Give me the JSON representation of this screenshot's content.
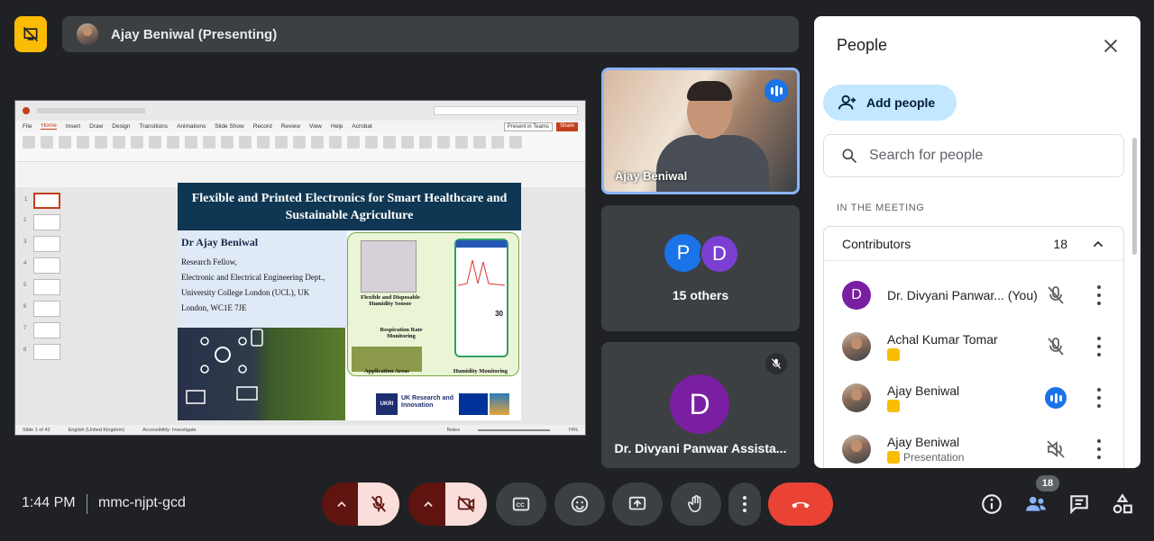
{
  "header": {
    "presenter_label": "Ajay Beniwal (Presenting)"
  },
  "shared_screen": {
    "ppt_menu": [
      "File",
      "Home",
      "Insert",
      "Draw",
      "Design",
      "Transitions",
      "Animations",
      "Slide Show",
      "Record",
      "Review",
      "View",
      "Help",
      "Acrobat"
    ],
    "thumb_numbers": [
      "1",
      "2",
      "3",
      "4",
      "5",
      "6",
      "7",
      "8"
    ],
    "present_in_teams": "Present in Teams",
    "share": "Share",
    "status_left": "Slide 1 of 42",
    "status_lang": "English (United Kingdom)",
    "status_access": "Accessibility: Investigate",
    "status_notes": "Notes",
    "status_zoom": "74%",
    "slide": {
      "title": "Flexible and Printed Electronics for Smart Healthcare and Sustainable Agriculture",
      "author": "Dr Ajay Beniwal",
      "lines": [
        "Research Fellow,",
        "Electronic and Electrical Engineering Dept.,",
        "University College London (UCL), UK",
        "London, WC1E 7JE"
      ],
      "sensor_caption": "Flexible and Disposable Humidity Sensor",
      "respiration": "Respiration Rate Monitoring",
      "application_areas": "Application Areas",
      "humidity_monitoring": "Humidity Monitoring",
      "reading": "30",
      "funder": "UK Research and Innovation",
      "funder_short": "UKRI"
    }
  },
  "tiles": {
    "ajay_label": "Ajay Beniwal",
    "others": {
      "avatars": [
        {
          "letter": "P",
          "color": "#1a73e8"
        },
        {
          "letter": "D",
          "color": "#7b3fd1"
        }
      ],
      "label": "15 others"
    },
    "divyani": {
      "letter": "D",
      "color": "#7b1fa2",
      "label": "Dr. Divyani Panwar Assista..."
    }
  },
  "people_panel": {
    "title": "People",
    "add_people": "Add people",
    "search_placeholder": "Search for people",
    "section_label": "IN THE MEETING",
    "group": {
      "name": "Contributors",
      "count": "18"
    },
    "participants": [
      {
        "name": "Dr. Divyani Panwar... (You)",
        "avatar_letter": "D",
        "avatar_color": "#7b1fa2",
        "status": "muted"
      },
      {
        "name": "Achal Kumar Tomar",
        "status": "muted"
      },
      {
        "name": "Ajay Beniwal",
        "status": "speaking"
      },
      {
        "name": "Ajay Beniwal",
        "sub": "Presentation",
        "status": "audio-off"
      }
    ]
  },
  "bottom_bar": {
    "time": "1:44 PM",
    "meeting_code": "mmc-njpt-gcd",
    "people_count": "18"
  },
  "colors": {
    "background": "#202124",
    "accent_blue": "#1a73e8",
    "end_call": "#ea4335",
    "muted_red_bg": "#f9dedc"
  }
}
